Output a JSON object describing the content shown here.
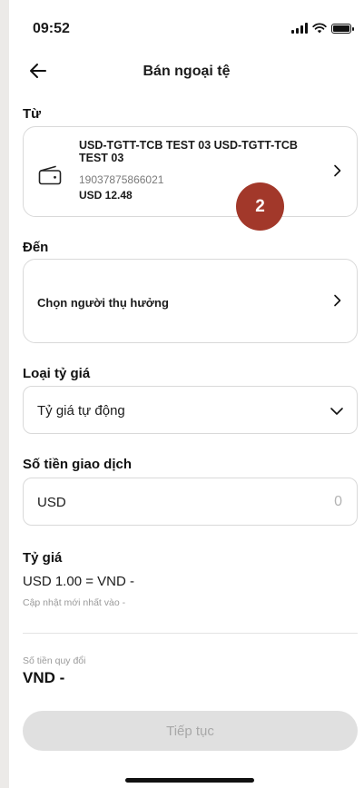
{
  "status_bar": {
    "time": "09:52"
  },
  "header": {
    "title": "Bán ngoại tệ"
  },
  "from": {
    "label": "Từ",
    "account_name": "USD-TGTT-TCB TEST 03 USD-TGTT-TCB TEST 03",
    "account_number": "19037875866021",
    "balance": "USD 12.48"
  },
  "step_badge": "2",
  "to": {
    "label": "Đến",
    "placeholder": "Chọn người thụ hưởng"
  },
  "rate_type": {
    "label": "Loại tỷ giá",
    "selected": "Tỷ giá tự động"
  },
  "amount": {
    "label": "Số tiền giao dịch",
    "currency": "USD",
    "placeholder": "0"
  },
  "exchange_rate": {
    "label": "Tỷ giá",
    "value": "USD 1.00 = VND -",
    "updated": "Cập nhật mới nhất vào -"
  },
  "converted": {
    "label": "Số tiền quy đổi",
    "value": "VND -"
  },
  "continue_button": {
    "label": "Tiếp tục",
    "enabled": false
  },
  "colors": {
    "badge": "#a2382a",
    "button_disabled_bg": "#e0e0e0",
    "button_disabled_text": "#a8a8a8",
    "border": "#d9d9d9"
  }
}
